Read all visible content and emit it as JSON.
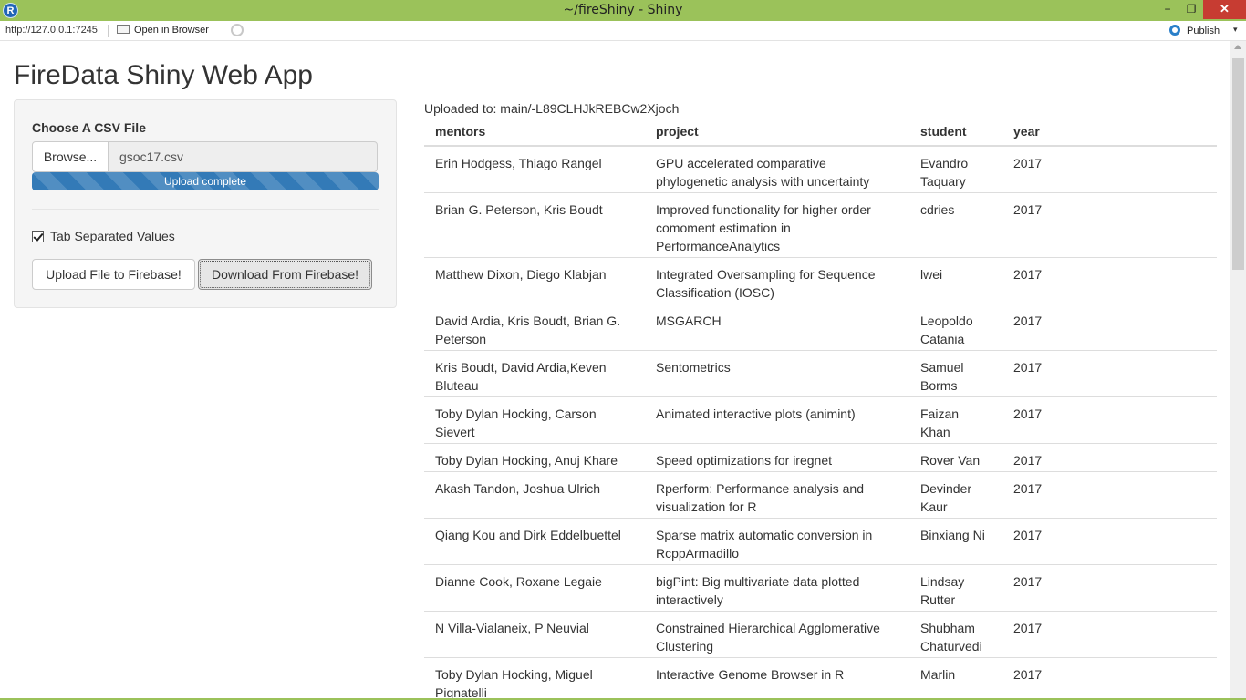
{
  "window": {
    "title": "~/fireShiny - Shiny",
    "r_logo": "R",
    "minimize": "−",
    "maximize": "❐",
    "close": "✕"
  },
  "toolbar": {
    "url": "http://127.0.0.1:7245",
    "open_in_browser": "Open in Browser",
    "publish": "Publish",
    "publish_menu": "▾"
  },
  "app": {
    "title": "FireData Shiny Web App",
    "file_input": {
      "label": "Choose A CSV File",
      "browse_label": "Browse...",
      "file_name": "gsoc17.csv",
      "progress_text": "Upload complete",
      "progress": 1.0
    },
    "checkbox": {
      "label": "Tab Separated Values",
      "checked": true
    },
    "upload_button": "Upload File to Firebase!",
    "download_button": "Download From Firebase!",
    "upload_message": "Uploaded to: main/-L89CLHJkREBCw2Xjoch",
    "table": {
      "columns": [
        "mentors",
        "project",
        "student",
        "year"
      ],
      "rows": [
        [
          "Erin Hodgess, Thiago Rangel",
          "GPU accelerated comparative phylogenetic analysis with uncertainty",
          "Evandro Taquary",
          "2017"
        ],
        [
          "Brian G. Peterson, Kris Boudt",
          "Improved functionality for higher order comoment estimation in PerformanceAnalytics",
          "cdries",
          "2017"
        ],
        [
          "Matthew Dixon, Diego Klabjan",
          "Integrated Oversampling for Sequence Classification (IOSC)",
          "lwei",
          "2017"
        ],
        [
          "David Ardia, Kris Boudt, Brian G. Peterson",
          "MSGARCH",
          "Leopoldo Catania",
          "2017"
        ],
        [
          "Kris Boudt, David Ardia,Keven Bluteau",
          "Sentometrics",
          "Samuel Borms",
          "2017"
        ],
        [
          "Toby Dylan Hocking, Carson Sievert",
          "Animated interactive plots (animint)",
          "Faizan Khan",
          "2017"
        ],
        [
          "Toby Dylan Hocking, Anuj Khare",
          "Speed optimizations for iregnet",
          "Rover Van",
          "2017"
        ],
        [
          "Akash Tandon, Joshua Ulrich",
          "Rperform: Performance analysis and visualization for R",
          "Devinder Kaur",
          "2017"
        ],
        [
          "Qiang Kou and Dirk Eddelbuettel",
          "Sparse matrix automatic conversion in RcppArmadillo",
          "Binxiang Ni",
          "2017"
        ],
        [
          "Dianne Cook, Roxane Legaie",
          "bigPint: Big multivariate data plotted interactively",
          "Lindsay Rutter",
          "2017"
        ],
        [
          "N Villa-Vialaneix, P Neuvial",
          "Constrained Hierarchical Agglomerative Clustering",
          "Shubham Chaturvedi",
          "2017"
        ],
        [
          "Toby Dylan Hocking, Miguel Pignatelli",
          "Interactive Genome Browser in R",
          "Marlin",
          "2017"
        ]
      ]
    }
  }
}
